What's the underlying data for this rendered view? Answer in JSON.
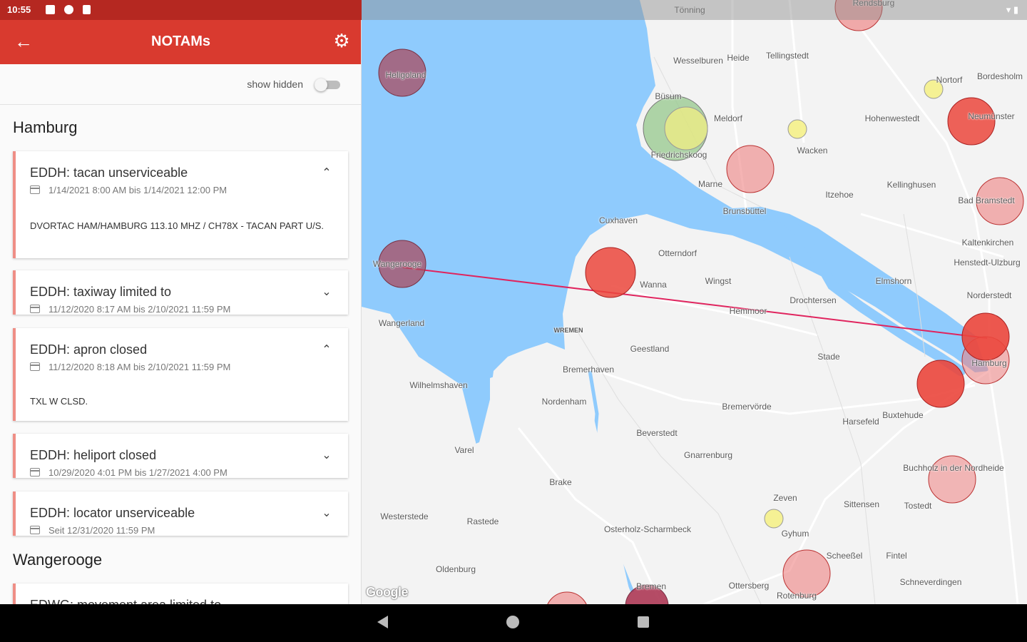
{
  "status_bar": {
    "time": "10:55"
  },
  "app_bar": {
    "title": "NOTAMs"
  },
  "filter": {
    "show_hidden_label": "show hidden",
    "show_hidden": false
  },
  "sections": [
    {
      "name": "Hamburg",
      "notams": [
        {
          "title": "EDDH: tacan unserviceable",
          "date": "1/14/2021 8:00 AM bis 1/14/2021 12:00 PM",
          "expanded": true,
          "body": "DVORTAC HAM/HAMBURG 113.10 MHZ / CH78X - TACAN PART U/S."
        },
        {
          "title": "EDDH: taxiway limited to",
          "date": "11/12/2020 8:17 AM bis 2/10/2021 11:59 PM",
          "expanded": false
        },
        {
          "title": "EDDH: apron closed",
          "date": "11/12/2020 8:18 AM bis 2/10/2021 11:59 PM",
          "expanded": true,
          "body": "TXL W CLSD."
        },
        {
          "title": "EDDH: heliport closed",
          "date": "10/29/2020 4:01 PM bis 1/27/2021 4:00 PM",
          "expanded": false
        },
        {
          "title": "EDDH: locator unserviceable",
          "date": "Seit 12/31/2020 11:59 PM",
          "expanded": false
        }
      ]
    },
    {
      "name": "Wangerooge",
      "notams": [
        {
          "title": "EDWG: movement area limited to",
          "date": "",
          "expanded": false
        }
      ]
    }
  ],
  "map": {
    "colors": {
      "water": "#8fcbfd",
      "land": "#f3f3f3",
      "road": "#ffffff",
      "route": "#e0245e"
    },
    "places": [
      {
        "name": "Wesselburen",
        "sea": false
      },
      {
        "name": "Heide",
        "sea": false
      },
      {
        "name": "Tellingstedt",
        "sea": false
      },
      {
        "name": "Büsum",
        "sea": false
      },
      {
        "name": "Meldorf",
        "sea": false
      },
      {
        "name": "Friedrichskoog",
        "sea": false
      },
      {
        "name": "Marne",
        "sea": false
      },
      {
        "name": "Wacken",
        "sea": false
      },
      {
        "name": "Hohenwestedt",
        "sea": false
      },
      {
        "name": "Nortorf",
        "sea": false
      },
      {
        "name": "Bordesholm",
        "sea": false
      },
      {
        "name": "Neumünster",
        "sea": false
      },
      {
        "name": "Itzehoe",
        "sea": false
      },
      {
        "name": "Kellinghusen",
        "sea": false
      },
      {
        "name": "Bad Bramstedt",
        "sea": false
      },
      {
        "name": "Brunsbüttel",
        "sea": false
      },
      {
        "name": "Cuxhaven",
        "sea": false
      },
      {
        "name": "Otterndorf",
        "sea": false
      },
      {
        "name": "Wingst",
        "sea": false
      },
      {
        "name": "Wanna",
        "sea": false
      },
      {
        "name": "Hemmoor",
        "sea": false
      },
      {
        "name": "Drochtersen",
        "sea": false
      },
      {
        "name": "Elmshorn",
        "sea": false
      },
      {
        "name": "Kaltenkirchen",
        "sea": false
      },
      {
        "name": "Henstedt-Ulzburg",
        "sea": false
      },
      {
        "name": "Norderstedt",
        "sea": false
      },
      {
        "name": "Hamburg",
        "sea": false
      },
      {
        "name": "Wangerooge",
        "sea": false
      },
      {
        "name": "Wangerland",
        "sea": false
      },
      {
        "name": "Geestland",
        "sea": false
      },
      {
        "name": "WREMEN",
        "sea": true
      },
      {
        "name": "Stade",
        "sea": false
      },
      {
        "name": "Wilhelmshaven",
        "sea": false
      },
      {
        "name": "Bremerhaven",
        "sea": false
      },
      {
        "name": "Nordenham",
        "sea": false
      },
      {
        "name": "Bremervörde",
        "sea": false
      },
      {
        "name": "Buxtehude",
        "sea": false
      },
      {
        "name": "Harsefeld",
        "sea": false
      },
      {
        "name": "Varel",
        "sea": false
      },
      {
        "name": "Beverstedt",
        "sea": false
      },
      {
        "name": "Gnarrenburg",
        "sea": false
      },
      {
        "name": "Buchholz in der Nordheide",
        "sea": false
      },
      {
        "name": "Brake",
        "sea": false
      },
      {
        "name": "Zeven",
        "sea": false
      },
      {
        "name": "Sittensen",
        "sea": false
      },
      {
        "name": "Tostedt",
        "sea": false
      },
      {
        "name": "Westerstede",
        "sea": false
      },
      {
        "name": "Rastede",
        "sea": false
      },
      {
        "name": "Osterholz-Scharmbeck",
        "sea": false
      },
      {
        "name": "Gyhum",
        "sea": false
      },
      {
        "name": "Scheeßel",
        "sea": false
      },
      {
        "name": "Fintel",
        "sea": false
      },
      {
        "name": "Oldenburg",
        "sea": false
      },
      {
        "name": "Bremen",
        "sea": false
      },
      {
        "name": "Ottersberg",
        "sea": false
      },
      {
        "name": "Schneverdingen",
        "sea": false
      },
      {
        "name": "Rotenburg",
        "sea": false
      },
      {
        "name": "Heligoland",
        "sea": false
      },
      {
        "name": "Tönning",
        "sea": false
      },
      {
        "name": "Rendsburg",
        "sea": false
      }
    ],
    "attribution": "Google"
  }
}
